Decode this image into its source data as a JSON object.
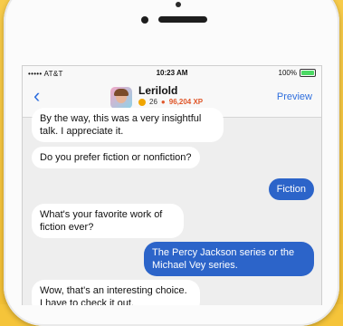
{
  "status_bar": {
    "carrier": "••••• AT&T",
    "time": "10:23 AM",
    "battery": "100%",
    "battery_level": 1.0
  },
  "header": {
    "back_label": "‹",
    "bot_name": "Lerilold",
    "level": "26",
    "xp": "96,204 XP",
    "xp_progress": 0.35,
    "preview_label": "Preview"
  },
  "messages": [
    {
      "sender": "bot",
      "text": "By the way, this was a very insightful talk. I appreciate it."
    },
    {
      "sender": "bot",
      "text": "Do you prefer fiction or nonfiction?"
    },
    {
      "sender": "user",
      "text": "Fiction"
    },
    {
      "sender": "bot",
      "text": "What's your favorite work of fiction ever?"
    },
    {
      "sender": "user",
      "text": "The Percy Jackson series or the Michael Vey series."
    },
    {
      "sender": "bot",
      "text": "Wow, that's an interesting choice. I have to check it out."
    }
  ],
  "colors": {
    "accent": "#2f6fde",
    "user_bubble": "#2c64c9",
    "xp": "#e0572a",
    "background": "#f5c43a"
  }
}
